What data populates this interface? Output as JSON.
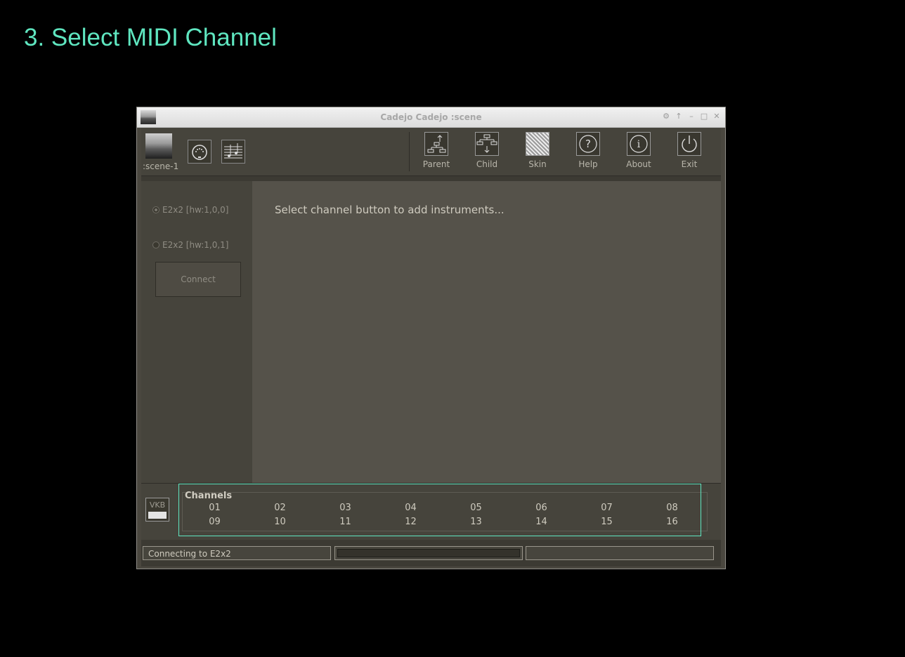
{
  "heading": "3. Select MIDI Channel",
  "window": {
    "title": "Cadejo Cadejo :scene",
    "controls": [
      "gear-icon",
      "arrow-up-icon",
      "minimize-icon",
      "maximize-icon",
      "close-icon"
    ]
  },
  "toolbar": {
    "scene_label": ":scene-1",
    "tools": [
      {
        "label": "Parent",
        "icon": "parent-icon"
      },
      {
        "label": "Child",
        "icon": "child-icon"
      },
      {
        "label": "Skin",
        "icon": "skin-icon"
      },
      {
        "label": "Help",
        "icon": "help-icon"
      },
      {
        "label": "About",
        "icon": "about-icon"
      },
      {
        "label": "Exit",
        "icon": "power-icon"
      }
    ]
  },
  "midi_inputs": {
    "options": [
      "E2x2 [hw:1,0,0]",
      "E2x2 [hw:1,0,1]"
    ],
    "selected": "E2x2 [hw:1,0,0]",
    "connect_label": "Connect"
  },
  "main": {
    "message": "Select channel button to add instruments..."
  },
  "channels": {
    "title": "Channels",
    "row1": [
      "01",
      "02",
      "03",
      "04",
      "05",
      "06",
      "07",
      "08"
    ],
    "row2": [
      "09",
      "10",
      "11",
      "12",
      "13",
      "14",
      "15",
      "16"
    ],
    "vkb_label": "VKB"
  },
  "status": {
    "text": "Connecting to E2x2"
  },
  "colors": {
    "accent": "#5fe6c0"
  }
}
